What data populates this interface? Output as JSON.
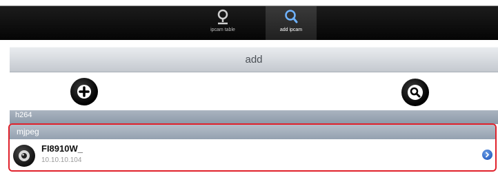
{
  "tabbar": {
    "tabs": [
      {
        "label": "ipcam table",
        "icon": "camera-pin-icon",
        "active": false
      },
      {
        "label": "add ipcam",
        "icon": "search-icon",
        "active": true
      }
    ]
  },
  "add_bar": {
    "label": "add"
  },
  "actions": {
    "add_icon": "plus-circle-icon",
    "search_icon": "search-circle-icon"
  },
  "sections": {
    "h264": {
      "label": "h264"
    },
    "mjpeg": {
      "label": "mjpeg"
    }
  },
  "camera": {
    "name": "FI8910W_",
    "ip": "10.10.10.104",
    "icon": "webcam-icon",
    "accessory_icon": "disclosure-arrow-icon"
  },
  "colors": {
    "highlight": "#e0202a",
    "section_header": "#94a1b0",
    "disclosure": "#2c63c4"
  }
}
